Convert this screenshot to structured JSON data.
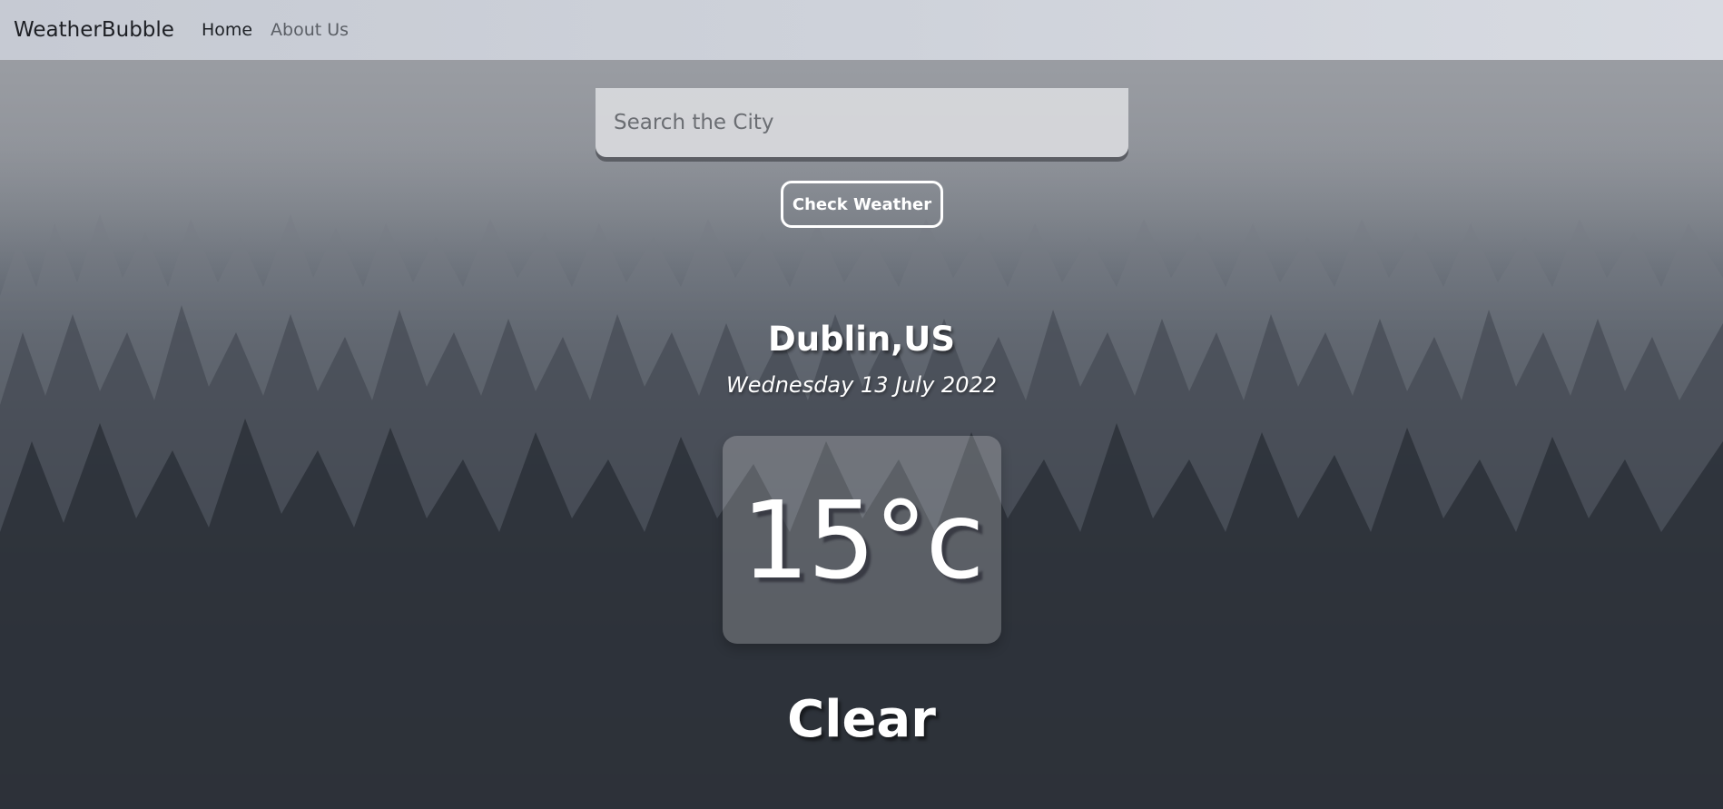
{
  "navbar": {
    "brand": "WeatherBubble",
    "links": [
      {
        "label": "Home",
        "active": true
      },
      {
        "label": "About Us",
        "active": false
      }
    ]
  },
  "search": {
    "placeholder": "Search the City",
    "value": ""
  },
  "check_button": {
    "label": "Check Weather"
  },
  "weather": {
    "location": "Dublin,US",
    "date": "Wednesday 13 July 2022",
    "temperature": "15°c",
    "condition": "Clear"
  },
  "colors": {
    "text": "#ffffff",
    "navbar_bg": "#ced2da",
    "brand_text": "#1d1f24"
  }
}
